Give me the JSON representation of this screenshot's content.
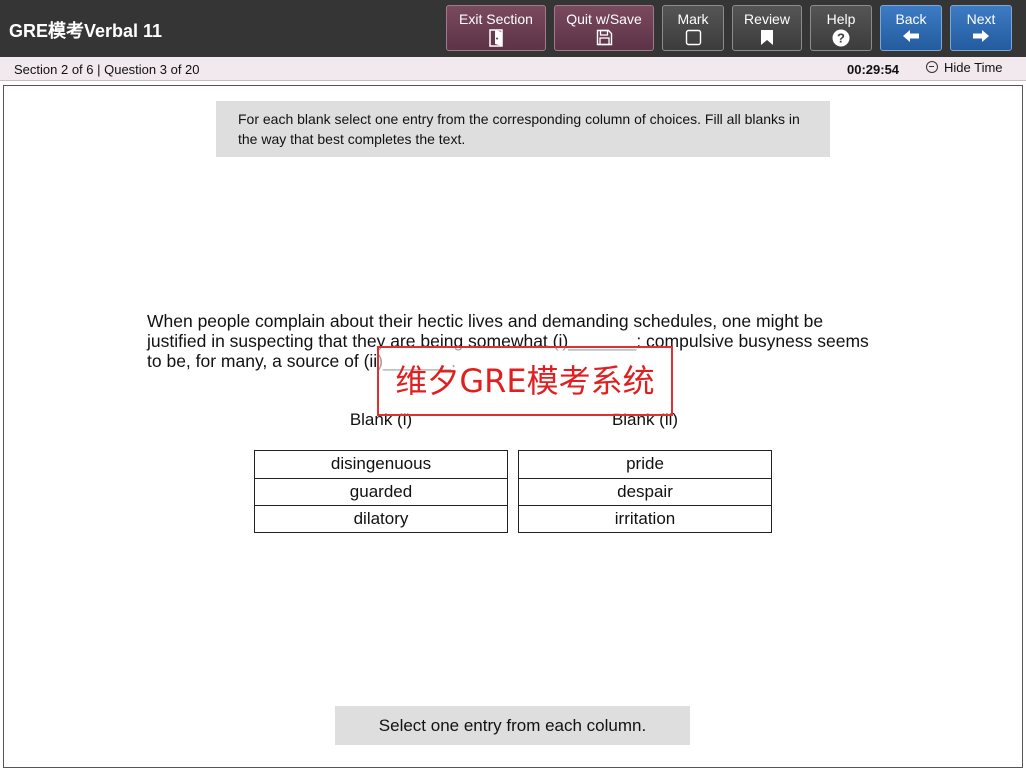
{
  "header": {
    "title": "GRE模考Verbal 11",
    "buttons": [
      {
        "label": "Exit Section",
        "icon": "exit-door-icon"
      },
      {
        "label": "Quit w/Save",
        "icon": "save-disk-icon"
      },
      {
        "label": "Mark",
        "icon": "checkbox-icon"
      },
      {
        "label": "Review",
        "icon": "bookmark-icon"
      },
      {
        "label": "Help",
        "icon": "question-circle-icon"
      },
      {
        "label": "Back",
        "icon": "arrow-left-icon"
      },
      {
        "label": "Next",
        "icon": "arrow-right-icon"
      }
    ]
  },
  "status": {
    "progress": "Section 2 of 6 | Question 3 of 20",
    "time": "00:29:54",
    "hide_time": "Hide Time"
  },
  "directions": "For each blank select one entry from the corresponding column of choices. Fill all blanks in the way that best completes the text.",
  "question": {
    "text": "When people complain about their hectic lives and demanding schedules, one might be justified in suspecting that they are being somewhat (i)_______: compulsive busyness seems to be, for many, a source of (ii)_______."
  },
  "blanks": [
    {
      "label": "Blank (i)",
      "choices": [
        "disingenuous",
        "guarded",
        "dilatory"
      ]
    },
    {
      "label": "Blank (ii)",
      "choices": [
        "pride",
        "despair",
        "irritation"
      ]
    }
  ],
  "watermark": "维夕GRE模考系统",
  "footer_instruction": "Select one entry from each column.",
  "colors": {
    "topbar": "#353535",
    "exit_buttons": "#6b3e52",
    "nav_buttons": "#2a66ad",
    "status_bar": "#f2e9ee",
    "watermark": "#e02020"
  }
}
